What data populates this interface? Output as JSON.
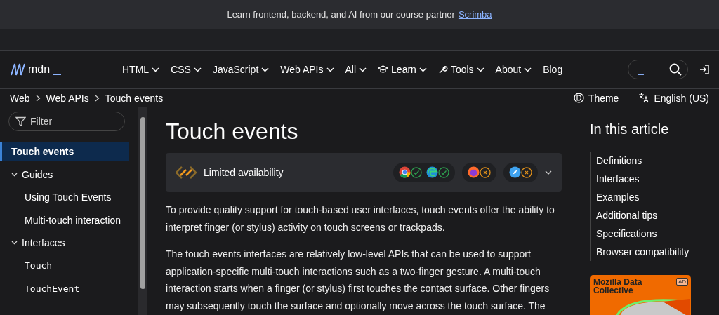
{
  "banner": {
    "text": "Learn frontend, backend, and AI from our course partner",
    "link": "Scrimba"
  },
  "nav": {
    "logo": "mdn",
    "items": [
      {
        "label": "HTML",
        "kind": "menu"
      },
      {
        "label": "CSS",
        "kind": "menu"
      },
      {
        "label": "JavaScript",
        "kind": "menu"
      },
      {
        "label": "Web APIs",
        "kind": "menu"
      },
      {
        "label": "All",
        "kind": "menu"
      },
      {
        "label": "Learn",
        "kind": "learn"
      },
      {
        "label": "Tools",
        "kind": "tools"
      },
      {
        "label": "About",
        "kind": "menu"
      },
      {
        "label": "Blog",
        "kind": "link"
      }
    ],
    "search_value": "_"
  },
  "breadcrumbs": [
    "Web",
    "Web APIs",
    "Touch events"
  ],
  "theme": "Theme",
  "language": "English (US)",
  "sidebar": {
    "filter_placeholder": "Filter",
    "items": [
      {
        "label": "Touch events",
        "selected": true
      },
      {
        "label": "Guides",
        "selected": false,
        "expanded": true,
        "children": [
          {
            "label": "Using Touch Events",
            "kind": "text",
            "selected": false
          },
          {
            "label": "Multi-touch interaction",
            "kind": "text",
            "selected": false
          }
        ]
      },
      {
        "label": "Interfaces",
        "selected": false,
        "expanded": true,
        "children": [
          {
            "label": "Touch",
            "kind": "code",
            "selected": false
          },
          {
            "label": "TouchEvent",
            "kind": "code",
            "selected": false
          }
        ]
      }
    ]
  },
  "article": {
    "title": "Touch events",
    "availability": "Limited availability",
    "browser_groups": [
      [
        {
          "kind": "chrome",
          "supported": true
        },
        {
          "kind": "edge",
          "supported": true
        }
      ],
      [
        {
          "kind": "firefox",
          "supported": false
        }
      ],
      [
        {
          "kind": "safari",
          "supported": false
        }
      ]
    ],
    "paragraphs": [
      "To provide quality support for touch-based user interfaces, touch events offer the ability to interpret finger (or stylus) activity on touch screens or trackpads.",
      "The touch events interfaces are relatively low-level APIs that can be used to support application-specific multi-touch interactions such as a two-finger gesture. A multi-touch interaction starts when a finger (or stylus) first touches the contact surface. Other fingers may subsequently touch the surface and optionally move across the touch surface. The"
    ]
  },
  "toc": {
    "title": "In this article",
    "items": [
      "Definitions",
      "Interfaces",
      "Examples",
      "Additional tips",
      "Specifications",
      "Browser compatibility"
    ]
  },
  "ad": {
    "title": "Mozilla Data Collective",
    "badge": "AD"
  }
}
